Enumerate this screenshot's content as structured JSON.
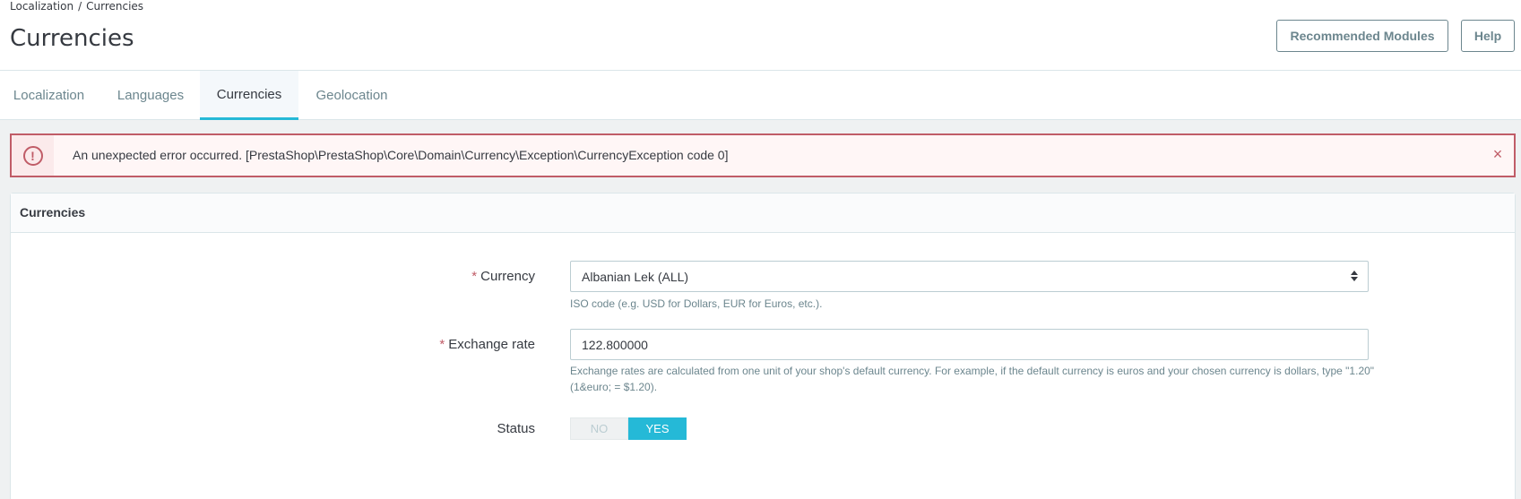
{
  "breadcrumb": {
    "parent": "Localization",
    "separator": "/",
    "current": "Currencies"
  },
  "page_title": "Currencies",
  "header_buttons": {
    "modules": "Recommended Modules",
    "help": "Help"
  },
  "tabs": [
    {
      "label": "Localization",
      "active": false
    },
    {
      "label": "Languages",
      "active": false
    },
    {
      "label": "Currencies",
      "active": true
    },
    {
      "label": "Geolocation",
      "active": false
    }
  ],
  "alert": {
    "icon": "alert-circle-icon",
    "message": "An unexpected error occurred. [PrestaShop\\PrestaShop\\Core\\Domain\\Currency\\Exception\\CurrencyException code 0]",
    "close": "×"
  },
  "panel": {
    "title": "Currencies",
    "currency": {
      "required": "*",
      "label": "Currency",
      "value": "Albanian Lek (ALL)",
      "help": "ISO code (e.g. USD for Dollars, EUR for Euros, etc.)."
    },
    "exchange_rate": {
      "required": "*",
      "label": "Exchange rate",
      "value": "122.800000",
      "help": "Exchange rates are calculated from one unit of your shop's default currency. For example, if the default currency is euros and your chosen currency is dollars, type \"1.20\" (1&euro; = $1.20)."
    },
    "status": {
      "label": "Status",
      "off_label": "NO",
      "on_label": "YES",
      "value": "YES"
    }
  },
  "colors": {
    "accent": "#25b9d7",
    "error": "#c05c67",
    "text": "#363a41",
    "muted": "#6c868e"
  }
}
